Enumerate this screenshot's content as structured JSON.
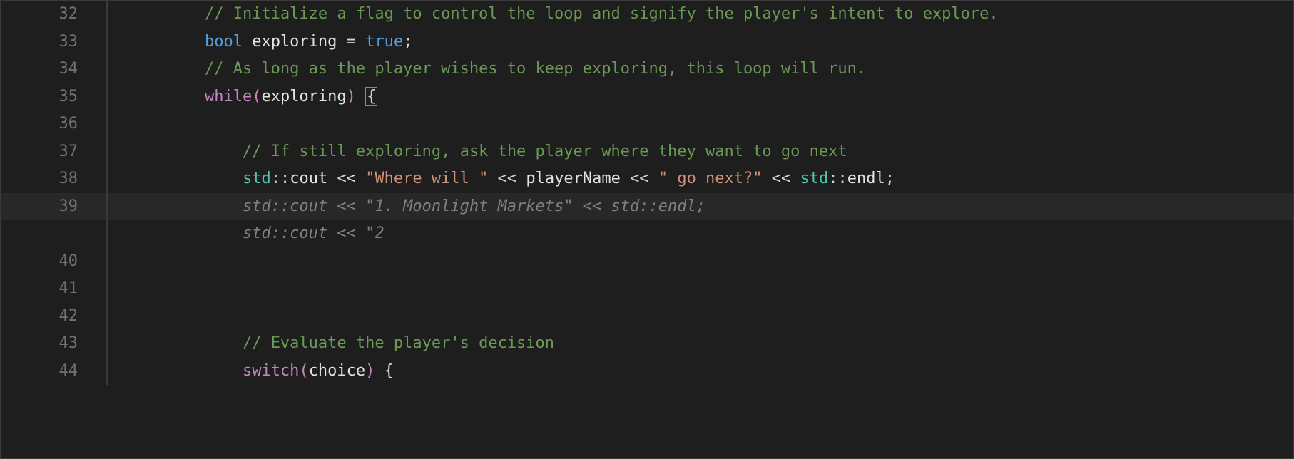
{
  "editor": {
    "lines": [
      {
        "n": 32,
        "indent": 2,
        "tokens": [
          {
            "t": "comment",
            "v": "// Initialize a flag to control the loop and signify the player's intent to explore."
          }
        ]
      },
      {
        "n": 33,
        "indent": 2,
        "tokens": [
          {
            "t": "keyword-type",
            "v": "bool"
          },
          {
            "t": "plain",
            "v": " "
          },
          {
            "t": "identifier",
            "v": "exploring"
          },
          {
            "t": "plain",
            "v": " "
          },
          {
            "t": "operator",
            "v": "="
          },
          {
            "t": "plain",
            "v": " "
          },
          {
            "t": "keyword-value",
            "v": "true"
          },
          {
            "t": "punctuation",
            "v": ";"
          }
        ]
      },
      {
        "n": 34,
        "indent": 2,
        "tokens": [
          {
            "t": "comment",
            "v": "// As long as the player wishes to keep exploring, this loop will run."
          }
        ]
      },
      {
        "n": 35,
        "indent": 2,
        "tokens": [
          {
            "t": "keyword-control",
            "v": "while"
          },
          {
            "t": "paren-highlight",
            "v": "("
          },
          {
            "t": "identifier",
            "v": "exploring"
          },
          {
            "t": "paren-highlight",
            "v": ")"
          },
          {
            "t": "plain",
            "v": " "
          },
          {
            "t": "brace-match",
            "v": "{"
          }
        ]
      },
      {
        "n": 36,
        "indent": 2,
        "tokens": []
      },
      {
        "n": 37,
        "indent": 3,
        "tokens": [
          {
            "t": "comment",
            "v": "// If still exploring, ask the player where they want to go next"
          }
        ]
      },
      {
        "n": 38,
        "indent": 3,
        "tokens": [
          {
            "t": "namespace",
            "v": "std"
          },
          {
            "t": "double-colon",
            "v": "::"
          },
          {
            "t": "identifier",
            "v": "cout"
          },
          {
            "t": "plain",
            "v": " "
          },
          {
            "t": "operator",
            "v": "<<"
          },
          {
            "t": "plain",
            "v": " "
          },
          {
            "t": "string",
            "v": "\"Where will \""
          },
          {
            "t": "plain",
            "v": " "
          },
          {
            "t": "operator",
            "v": "<<"
          },
          {
            "t": "plain",
            "v": " "
          },
          {
            "t": "identifier",
            "v": "playerName"
          },
          {
            "t": "plain",
            "v": " "
          },
          {
            "t": "operator",
            "v": "<<"
          },
          {
            "t": "plain",
            "v": " "
          },
          {
            "t": "string",
            "v": "\" go next?\""
          },
          {
            "t": "plain",
            "v": " "
          },
          {
            "t": "operator",
            "v": "<<"
          },
          {
            "t": "plain",
            "v": " "
          },
          {
            "t": "namespace",
            "v": "std"
          },
          {
            "t": "double-colon",
            "v": "::"
          },
          {
            "t": "identifier",
            "v": "endl"
          },
          {
            "t": "punctuation",
            "v": ";"
          }
        ]
      },
      {
        "n": 39,
        "indent": 3,
        "highlighted": true,
        "tokens": [
          {
            "t": "ghost-text",
            "v": "std::cout << \"1. Moonlight Markets\" << std::endl;"
          }
        ]
      },
      {
        "n": null,
        "indent": 3,
        "ghost": true,
        "tokens": [
          {
            "t": "ghost-text",
            "v": "std::cout << \"2"
          }
        ]
      },
      {
        "n": 40,
        "indent": 2,
        "tokens": []
      },
      {
        "n": 41,
        "indent": 2,
        "tokens": []
      },
      {
        "n": 42,
        "indent": 2,
        "tokens": []
      },
      {
        "n": 43,
        "indent": 3,
        "tokens": [
          {
            "t": "comment",
            "v": "// Evaluate the player's decision"
          }
        ]
      },
      {
        "n": 44,
        "indent": 3,
        "tokens": [
          {
            "t": "keyword-control",
            "v": "switch"
          },
          {
            "t": "paren-highlight",
            "v": "("
          },
          {
            "t": "identifier",
            "v": "choice"
          },
          {
            "t": "paren-highlight",
            "v": ")"
          },
          {
            "t": "plain",
            "v": " "
          },
          {
            "t": "punctuation",
            "v": "{"
          }
        ]
      }
    ]
  }
}
